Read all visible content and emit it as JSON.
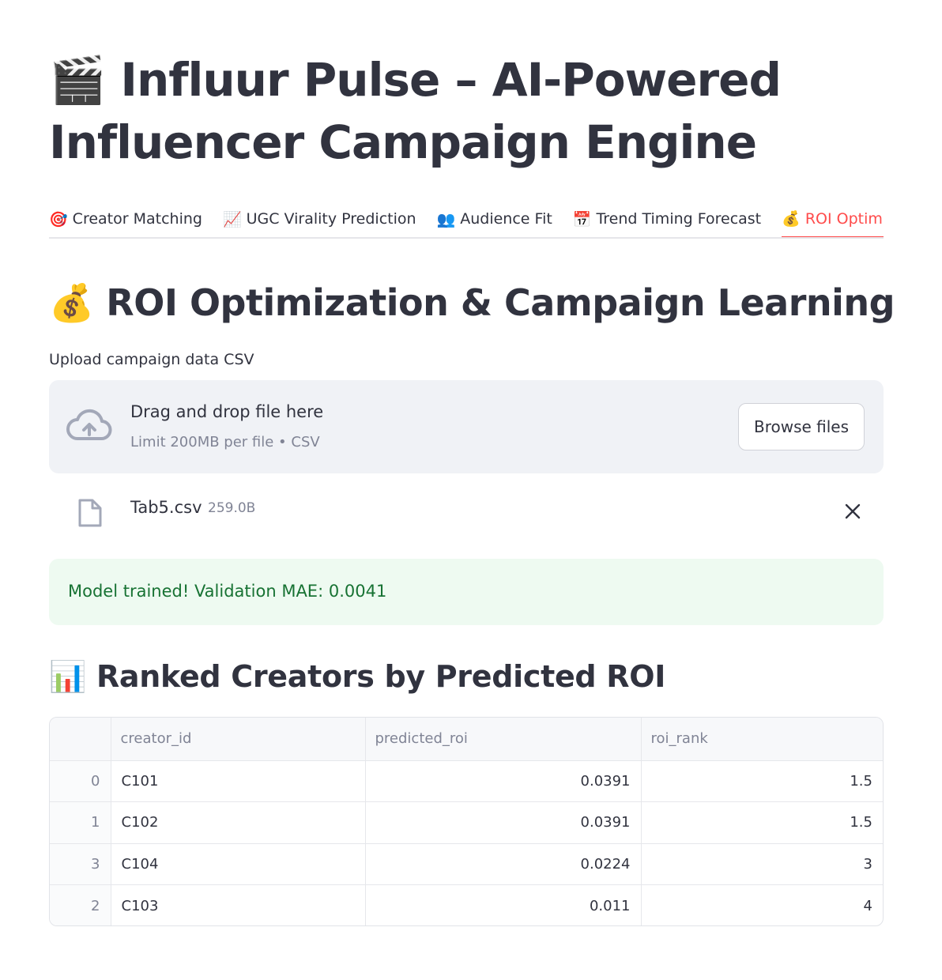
{
  "page": {
    "title_icon": "clapper-board-icon",
    "title": "🎬 Influur Pulse – AI-Powered Influencer Campaign Engine"
  },
  "tabs": [
    {
      "icon": "🎯",
      "label": "Creator Matching",
      "active": false
    },
    {
      "icon": "📈",
      "label": "UGC Virality Prediction",
      "active": false
    },
    {
      "icon": "👥",
      "label": "Audience Fit",
      "active": false
    },
    {
      "icon": "📅",
      "label": "Trend Timing Forecast",
      "active": false
    },
    {
      "icon": "💰",
      "label": "ROI Optimization",
      "active": true
    }
  ],
  "section": {
    "heading": "💰 ROI Optimization & Campaign Learning"
  },
  "uploader": {
    "label": "Upload campaign data CSV",
    "title": "Drag and drop file here",
    "subtitle": "Limit 200MB per file • CSV",
    "button": "Browse files"
  },
  "uploaded_file": {
    "name": "Tab5.csv",
    "size": "259.0B"
  },
  "alert": {
    "text": "Model trained! Validation MAE: 0.0041",
    "color": "#177233"
  },
  "ranked": {
    "heading": "📊 Ranked Creators by Predicted ROI",
    "columns": [
      "",
      "creator_id",
      "predicted_roi",
      "roi_rank"
    ],
    "rows": [
      {
        "index": "0",
        "creator_id": "C101",
        "predicted_roi": "0.0391",
        "roi_rank": "1.5"
      },
      {
        "index": "1",
        "creator_id": "C102",
        "predicted_roi": "0.0391",
        "roi_rank": "1.5"
      },
      {
        "index": "3",
        "creator_id": "C104",
        "predicted_roi": "0.0224",
        "roi_rank": "3"
      },
      {
        "index": "2",
        "creator_id": "C103",
        "predicted_roi": "0.011",
        "roi_rank": "4"
      }
    ]
  },
  "colors": {
    "accent": "#ff4b4b",
    "success_bg": "#eefaf1",
    "dropzone_bg": "#f0f2f6"
  }
}
